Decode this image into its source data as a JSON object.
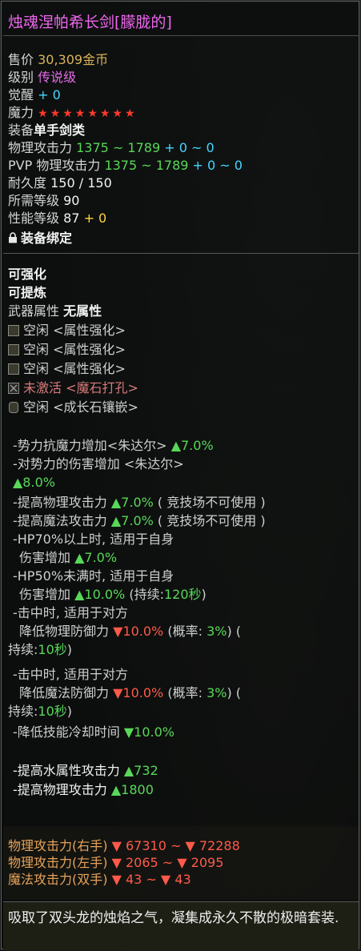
{
  "title": "烛魂涅帕希长剑[朦胧的]",
  "sell": {
    "label": "售价",
    "value": "30,309金币"
  },
  "grade": {
    "label": "级别",
    "value": "传说级"
  },
  "awaken": {
    "label": "觉醒",
    "value": "+ 0"
  },
  "magic": {
    "label": "魔力",
    "stars": "★★★★★★★★"
  },
  "equip": {
    "label": "装备",
    "value": "单手剑类"
  },
  "phys_atk": {
    "label": "物理攻击力",
    "value": "1375 ~ 1789",
    "bonus": "+ 0 ~ 0"
  },
  "pvp_atk": {
    "label": "PVP 物理攻击力",
    "value": "1375 ~ 1789",
    "bonus": "+ 0 ~ 0"
  },
  "durability": {
    "label": "耐久度",
    "value": "150 / 150"
  },
  "req_level": {
    "label": "所需等级",
    "value": "90"
  },
  "perf_level": {
    "label": "性能等级",
    "value": "87",
    "bonus": "+ 0"
  },
  "bind": {
    "label": "装备绑定"
  },
  "enhance": "可强化",
  "refine": "可提炼",
  "weapon_attr": {
    "label": "武器属性",
    "value": "无属性"
  },
  "slots": [
    {
      "state": "空闲",
      "type": "<属性强化>"
    },
    {
      "state": "空闲",
      "type": "<属性强化>"
    },
    {
      "state": "空闲",
      "type": "<属性强化>"
    },
    {
      "state": "未激活",
      "type": "<魔石打孔>"
    },
    {
      "state": "空闲",
      "type": "<成长石镶嵌>"
    }
  ],
  "effects": {
    "e1_text": "-势力抗魔力增加<朱达尔>",
    "e1_val": "▲7.0%",
    "e2_text": "-对势力的伤害增加 <朱达尔>",
    "e2_val": "▲8.0%",
    "e3_text": "-提高物理攻击力",
    "e3_val": "▲7.0%",
    "e3_note": "( 竞技场不可使用 )",
    "e4_text": "-提高魔法攻击力",
    "e4_val": "▲7.0%",
    "e4_note": "( 竞技场不可使用 )",
    "e5_text": "-HP70%以上时, 适用于自身",
    "e5b_text": "伤害增加",
    "e5_val": "▲7.0%",
    "e6_text": "-HP50%未满时, 适用于自身",
    "e6b_text": "伤害增加",
    "e6_val": "▲10.0%",
    "e6_dur_label": "(持续:",
    "e6_dur": "120秒",
    "e6_close": ")",
    "e7_text": "-击中时, 适用于对方",
    "e7b_text": "降低物理防御力",
    "e7_val": "▼10.0%",
    "e7_prob_label": "(概率:",
    "e7_prob": "3%",
    "e7_close": ") (",
    "e7_dur_label": "持续:",
    "e7_dur": "10秒",
    "e7_end": ")",
    "e8_text": "-击中时, 适用于对方",
    "e8b_text": "降低魔法防御力",
    "e8_val": "▼10.0%",
    "e8_prob_label": "(概率:",
    "e8_prob": "3%",
    "e8_close": ") (",
    "e8_dur_label": "持续:",
    "e8_dur": "10秒",
    "e8_end": ")",
    "e9_text": "-降低技能冷却时间",
    "e9_val": "▼10.0%",
    "e10_text": "-提高水属性攻击力",
    "e10_val": "▲732",
    "e11_text": "-提高物理攻击力",
    "e11_val": "▲1800"
  },
  "summary": [
    {
      "label": "物理攻击力(右手)",
      "value": "▼ 67310 ~ ▼ 72288"
    },
    {
      "label": "物理攻击力(左手)",
      "value": "▼ 2065 ~ ▼ 2095"
    },
    {
      "label": "魔法攻击力(双手)",
      "value": "▼ 43 ~ ▼ 43"
    }
  ],
  "description": "吸取了双头龙的烛焰之气，凝集成永久不散的极暗套装."
}
